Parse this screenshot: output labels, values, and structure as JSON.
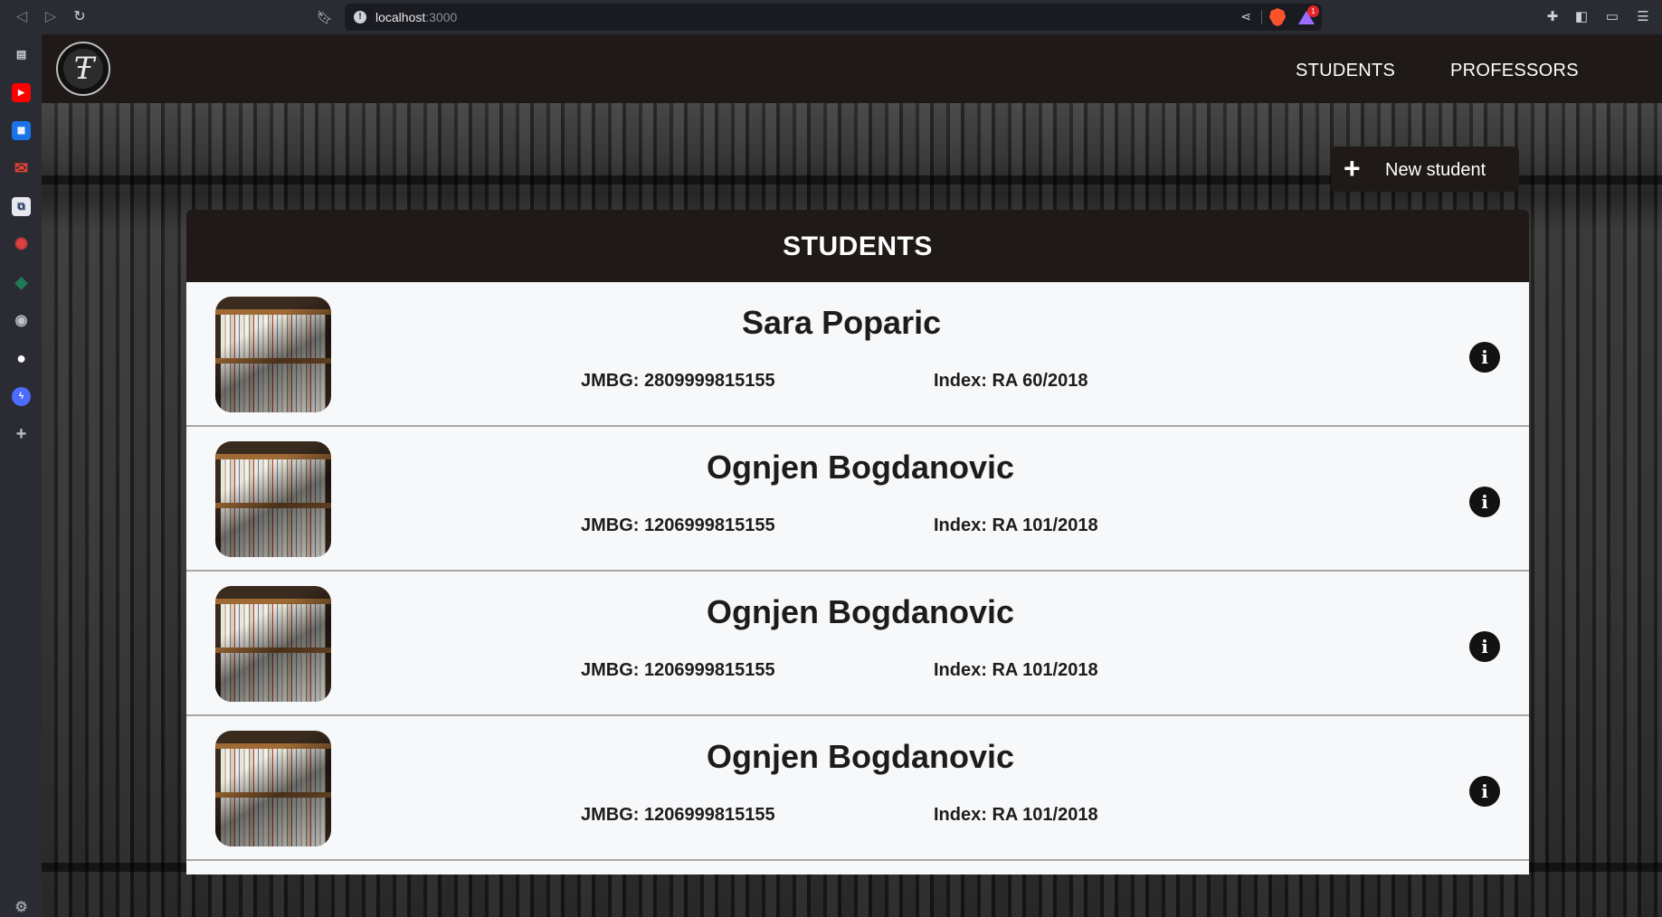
{
  "browser": {
    "url_host": "localhost",
    "url_port": ":3000",
    "reward_badge": "1"
  },
  "app": {
    "nav": {
      "students": "STUDENTS",
      "professors": "PROFESSORS"
    },
    "new_student_label": "New student",
    "card_title": "STUDENTS",
    "students": [
      {
        "name": "Sara Poparic",
        "jmbg": "JMBG: 2809999815155",
        "index": "Index: RA 60/2018"
      },
      {
        "name": "Ognjen Bogdanovic",
        "jmbg": "JMBG: 1206999815155",
        "index": "Index: RA 101/2018"
      },
      {
        "name": "Ognjen Bogdanovic",
        "jmbg": "JMBG: 1206999815155",
        "index": "Index: RA 101/2018"
      },
      {
        "name": "Ognjen Bogdanovic",
        "jmbg": "JMBG: 1206999815155",
        "index": "Index: RA 101/2018"
      }
    ]
  },
  "colors": {
    "header_bg": "#1f1a17",
    "card_bg": "#f7f8fa",
    "text_dark": "#1c1c1c"
  }
}
